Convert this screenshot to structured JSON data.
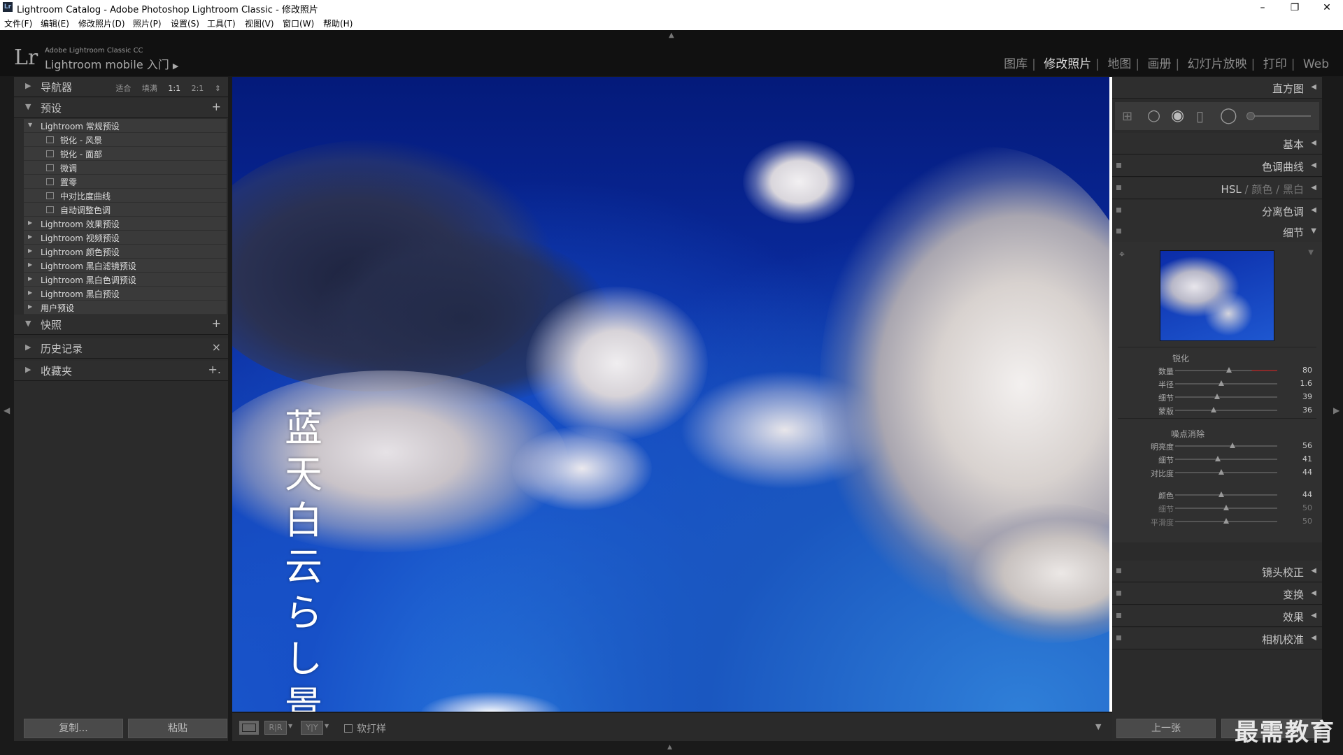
{
  "window": {
    "title": "Lightroom Catalog - Adobe Photoshop Lightroom Classic - 修改照片",
    "minimize": "–",
    "maximize": "❐",
    "close": "✕"
  },
  "menu": [
    "文件(F)",
    "编辑(E)",
    "修改照片(D)",
    "照片(P)",
    "设置(S)",
    "工具(T)",
    "视图(V)",
    "窗口(W)",
    "帮助(H)"
  ],
  "header": {
    "logo": "Lr",
    "brand_small": "Adobe Lightroom Classic CC",
    "brand_main": "Lightroom mobile 入门",
    "modules": [
      "图库",
      "修改照片",
      "地图",
      "画册",
      "幻灯片放映",
      "打印",
      "Web"
    ],
    "active_module": "修改照片"
  },
  "left": {
    "navigator": {
      "label": "导航器",
      "opts": [
        "适合",
        "填满",
        "1:1",
        "2:1"
      ]
    },
    "presets": {
      "label": "预设",
      "plus": "+"
    },
    "preset_groups": [
      {
        "name": "Lightroom 常规预设",
        "expanded": true,
        "items": [
          "锐化 - 风景",
          "锐化 - 面部",
          "微调",
          "置零",
          "中对比度曲线",
          "自动调整色调"
        ]
      },
      {
        "name": "Lightroom 效果预设"
      },
      {
        "name": "Lightroom 视频预设"
      },
      {
        "name": "Lightroom 颜色预设"
      },
      {
        "name": "Lightroom 黑白滤镜预设"
      },
      {
        "name": "Lightroom 黑白色调预设"
      },
      {
        "name": "Lightroom 黑白预设"
      },
      {
        "name": "用户预设"
      }
    ],
    "snapshots": {
      "label": "快照",
      "plus": "+"
    },
    "history": {
      "label": "历史记录",
      "clear": "×"
    },
    "collections": {
      "label": "收藏夹",
      "plus": "+."
    },
    "copy_btn": "复制...",
    "paste_btn": "粘贴"
  },
  "photo": {
    "overlay_text": [
      "蓝",
      "天",
      "白",
      "云",
      "ら",
      "し",
      "景"
    ]
  },
  "toolbar": {
    "softproof": "软打样",
    "view2": "R|R",
    "view3": "Y|Y"
  },
  "right": {
    "histogram": "直方图",
    "basic": "基本",
    "tone_curve": "色调曲线",
    "hsl": [
      "HSL",
      "颜色",
      "黑白"
    ],
    "split_toning": "分离色调",
    "detail": "细节",
    "sharpening": {
      "title": "锐化",
      "rows": [
        {
          "label": "数量",
          "value": "80",
          "pos": 0.53
        },
        {
          "label": "半径",
          "value": "1.6",
          "pos": 0.45
        },
        {
          "label": "细节",
          "value": "39",
          "pos": 0.41
        },
        {
          "label": "蒙版",
          "value": "36",
          "pos": 0.38
        }
      ]
    },
    "noise": {
      "title": "噪点消除",
      "rows": [
        {
          "label": "明亮度",
          "value": "56",
          "pos": 0.56
        },
        {
          "label": "细节",
          "value": "41",
          "pos": 0.42
        },
        {
          "label": "对比度",
          "value": "44",
          "pos": 0.45
        },
        {
          "label": "颜色",
          "value": "44",
          "pos": 0.45
        },
        {
          "label": "细节",
          "value": "50",
          "pos": 0.5
        },
        {
          "label": "平滑度",
          "value": "50",
          "pos": 0.5
        }
      ]
    },
    "lens": "镜头校正",
    "transform": "变换",
    "effects": "效果",
    "calibration": "相机校准",
    "prev_btn": "上一张"
  },
  "watermark": "最需教育"
}
